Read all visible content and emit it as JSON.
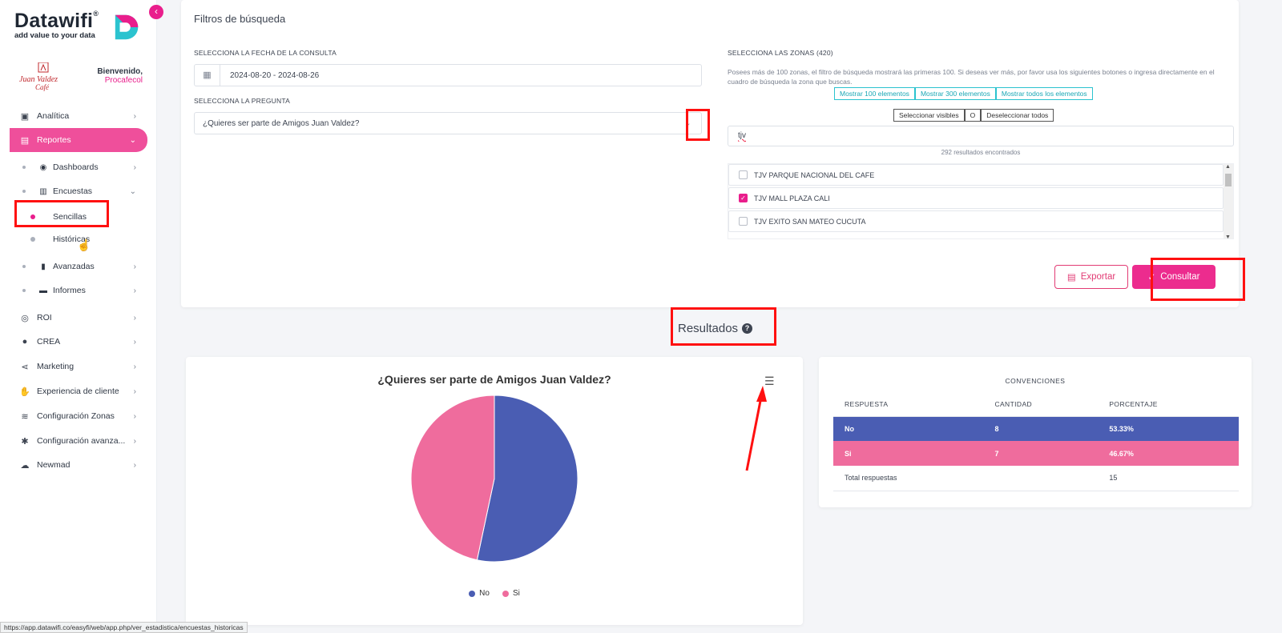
{
  "sidebar": {
    "logo_text": "Datawifi",
    "logo_reg": "®",
    "logo_tagline": "add value to your data",
    "collapse_icon": "chevron-left-icon",
    "welcome_title": "Bienvenido,",
    "welcome_user": "Procafecol",
    "brand_logo_text": "Juan Valdez Café",
    "items": [
      {
        "label": "Analítica",
        "icon": "chart-icon"
      },
      {
        "label": "Reportes",
        "icon": "document-icon",
        "active": true
      },
      {
        "label": "Dashboards",
        "icon": "compass-icon"
      },
      {
        "label": "Encuestas",
        "icon": "clipboard-icon"
      },
      {
        "label": "Sencillas"
      },
      {
        "label": "Históricas"
      },
      {
        "label": "Avanzadas",
        "icon": "bar-chart-icon"
      },
      {
        "label": "Informes",
        "icon": "book-icon"
      },
      {
        "label": "ROI",
        "icon": "coins-icon"
      },
      {
        "label": "CREA",
        "icon": "lightbulb-icon"
      },
      {
        "label": "Marketing",
        "icon": "share-icon"
      },
      {
        "label": "Experiencia de cliente",
        "icon": "thumbs-up-icon"
      },
      {
        "label": "Configuración Zonas",
        "icon": "wifi-icon"
      },
      {
        "label": "Configuración avanza...",
        "icon": "gear-icon"
      },
      {
        "label": "Newmad",
        "icon": "cloud-icon"
      }
    ]
  },
  "filters": {
    "title": "Filtros de búsqueda",
    "date_label": "SELECCIONA LA FECHA DE LA CONSULTA",
    "date_value": "2024-08-20 - 2024-08-26",
    "question_label": "SELECCIONA LA PREGUNTA",
    "question_value": "¿Quieres ser parte de Amigos Juan Valdez?",
    "zones_label": "SELECCIONA LAS ZONAS (420)",
    "zones_note": "Posees más de 100 zonas, el filtro de búsqueda mostrará las primeras 100. Si deseas ver más, por favor usa los siguientes botones o ingresa directamente en el cuadro de búsqueda la zona que buscas.",
    "show_100": "Mostrar 100 elementos",
    "show_300": "Mostrar 300 elementos",
    "show_all": "Mostrar todos los elementos",
    "select_visible": "Seleccionar visibles",
    "select_sep": "O",
    "deselect_all": "Deseleccionar todos",
    "zone_search_value": "tjv",
    "zone_count": "292 resultados encontrados",
    "zones": [
      {
        "name": "TJV PARQUE NACIONAL DEL CAFE",
        "checked": false
      },
      {
        "name": "TJV MALL PLAZA CALI",
        "checked": true
      },
      {
        "name": "TJV EXITO SAN MATEO CUCUTA",
        "checked": false
      }
    ],
    "export_label": "Exportar",
    "consult_label": "Consultar"
  },
  "results": {
    "title": "Resultados"
  },
  "colors": {
    "no": "#4a5db3",
    "si": "#ef6c9d",
    "accent": "#ec2c8e"
  },
  "chart_data": {
    "type": "pie",
    "title": "¿Quieres ser parte de Amigos Juan Valdez?",
    "categories": [
      "No",
      "Si"
    ],
    "values": [
      8,
      7
    ],
    "colors": [
      "#4a5db3",
      "#ef6c9d"
    ],
    "legend": "bottom"
  },
  "table": {
    "title": "CONVENCIONES",
    "headers": [
      "RESPUESTA",
      "CANTIDAD",
      "PORCENTAJE"
    ],
    "rows": [
      [
        "No",
        "8",
        "53.33%"
      ],
      [
        "Si",
        "7",
        "46.67%"
      ]
    ],
    "total_label": "Total respuestas",
    "total_value": "15"
  },
  "status_bar": {
    "url": "https://app.datawifi.co/easyfi/web/app.php/ver_estadistica/encuestas_historicas"
  }
}
